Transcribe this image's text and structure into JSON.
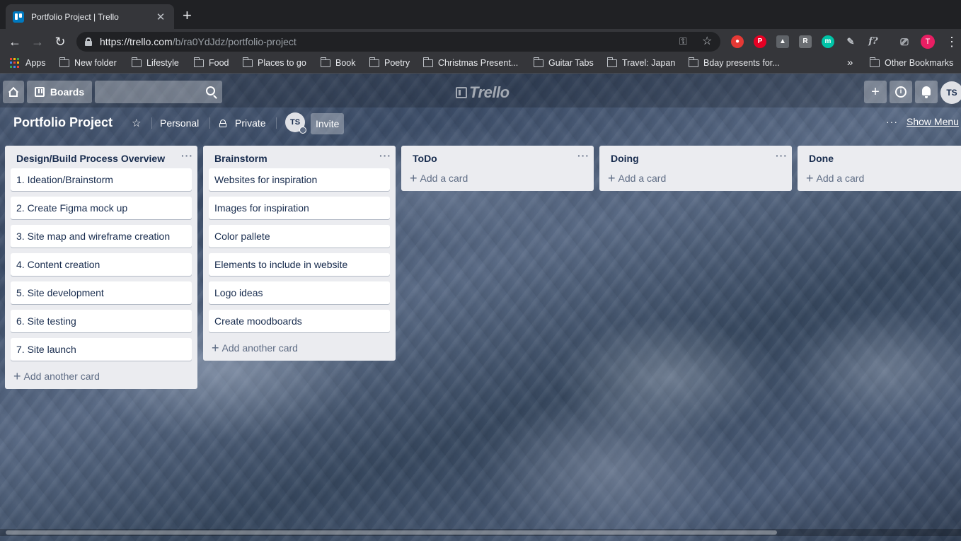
{
  "browser": {
    "tab_title": "Portfolio Project | Trello",
    "url_host": "https://trello.com",
    "url_path": "/b/ra0YdJdz/portfolio-project",
    "profile_initial": "T",
    "bookmarks": [
      {
        "label": "Apps",
        "type": "apps"
      },
      {
        "label": "New folder",
        "type": "folder"
      },
      {
        "label": "Lifestyle",
        "type": "folder"
      },
      {
        "label": "Food",
        "type": "folder"
      },
      {
        "label": "Places to go",
        "type": "folder"
      },
      {
        "label": "Book",
        "type": "folder"
      },
      {
        "label": "Poetry",
        "type": "folder"
      },
      {
        "label": "Christmas Present...",
        "type": "folder"
      },
      {
        "label": "Guitar Tabs",
        "type": "folder"
      },
      {
        "label": "Travel: Japan",
        "type": "folder"
      },
      {
        "label": "Bday presents for...",
        "type": "folder"
      }
    ],
    "other_bookmarks": "Other Bookmarks"
  },
  "trello": {
    "boards_label": "Boards",
    "logo_text": "Trello",
    "user_initials": "TS",
    "board": {
      "title": "Portfolio Project",
      "team": "Personal",
      "visibility": "Private",
      "member_initials": "TS",
      "invite_label": "Invite",
      "show_menu_label": "Show Menu"
    },
    "lists": [
      {
        "title": "Design/Build Process Overview",
        "cards": [
          "1. Ideation/Brainstorm",
          "2. Create Figma mock up",
          "3. Site map and wireframe creation",
          "4. Content creation",
          "5. Site development",
          "6. Site testing",
          "7. Site launch"
        ],
        "add_label": "Add another card"
      },
      {
        "title": "Brainstorm",
        "cards": [
          "Websites for inspiration",
          "Images for inspiration",
          "Color pallete",
          "Elements to include in website",
          "Logo ideas",
          "Create moodboards"
        ],
        "add_label": "Add another card"
      },
      {
        "title": "ToDo",
        "cards": [],
        "add_label": "Add a card"
      },
      {
        "title": "Doing",
        "cards": [],
        "add_label": "Add a card"
      },
      {
        "title": "Done",
        "cards": [],
        "add_label": "Add a card"
      }
    ]
  },
  "colors": {
    "list_bg": "#ebecf0",
    "text": "#172b4d",
    "muted": "#5e6c84",
    "profile": "#e91e63"
  }
}
